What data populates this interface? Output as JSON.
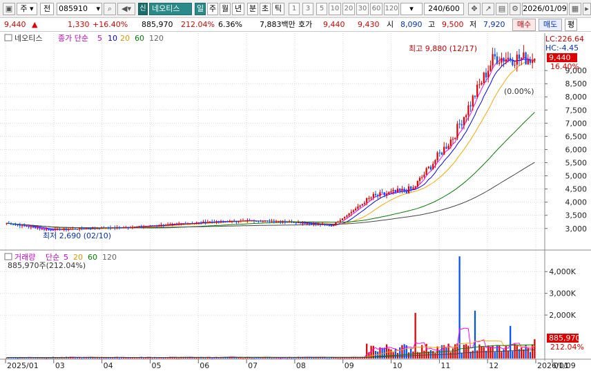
{
  "toolbar": {
    "market": "주",
    "market_btn": "전",
    "code": "085910",
    "name_badge": "신",
    "stock_name": "네오티스",
    "periods": [
      "일",
      "주",
      "월",
      "년",
      "분",
      "초",
      "틱"
    ],
    "active_period": "일",
    "intervals": [
      "1",
      "3",
      "5",
      "10",
      "20",
      "30",
      "60",
      "120"
    ],
    "count": "240",
    "count_max": "/600",
    "date": "2026/01/09"
  },
  "quote": {
    "price": "9,440",
    "arrow": "▲",
    "change": "1,330",
    "change_pct": "+16.40%",
    "volume": "885,970",
    "vol_ratio": "212.04%",
    "turnover": "6.36%",
    "amount": "7,883백만",
    "ask_label": "호가",
    "ask": "9,440",
    "bid": "9,430",
    "open_label": "시",
    "open": "8,090",
    "high_label": "고",
    "high": "9,500",
    "low_label": "저",
    "low": "7,920",
    "buy_btn": "매수",
    "sell_btn": "매도",
    "eval_btn": "평"
  },
  "legend": {
    "price_name": "네오티스",
    "price_ind": "종가 단순",
    "ma": [
      "5",
      "10",
      "20",
      "60",
      "120"
    ],
    "vol_name": "거래량",
    "vol_ind": "단순",
    "vol_ma": [
      "5",
      "20",
      "60",
      "120"
    ],
    "vol_value": "885,970주(212.04%)"
  },
  "annotations": {
    "high": "최고 9,880 (12/17)",
    "low": "최저 2,690 (02/10)",
    "center": "(0.00%)",
    "lc": "LC:226.64",
    "hc": "HC:-4.45"
  },
  "chart_data": {
    "type": "candlestick",
    "x_labels": [
      "2025/01",
      "03",
      "04",
      "05",
      "06",
      "07",
      "08",
      "09",
      "10",
      "11",
      "12",
      "2026/01",
      "01/09"
    ],
    "price_axis": {
      "ticks": [
        "3,000",
        "3,500",
        "4,000",
        "4,500",
        "5,000",
        "5,500",
        "6,000",
        "6,500",
        "7,000",
        "7,500",
        "8,000",
        "8,500",
        "9,000"
      ],
      "min": 2600,
      "max": 10000
    },
    "last_price": "9,440",
    "last_pct": "16.40%",
    "volume_axis": {
      "ticks": [
        "2,000K",
        "3,000K",
        "4,000K"
      ],
      "min": 0,
      "max": 4800000
    },
    "last_volume": "885,970",
    "last_vol_pct": "212.04%",
    "ma_colors": {
      "5": "#ff00ff",
      "10": "#0000ff",
      "20": "#ffa500",
      "60": "#008000",
      "120": "#444444"
    },
    "colors": {
      "up": "#e00000",
      "down": "#0050ff",
      "volume_label_bg": "#e00000",
      "price_label_bg": "#e00000"
    },
    "price_series": [
      {
        "month": "2025/01",
        "close": 3200
      },
      {
        "month": "02",
        "close": 2950
      },
      {
        "month": "03",
        "close": 3000
      },
      {
        "month": "04",
        "close": 3050
      },
      {
        "month": "05",
        "close": 3150
      },
      {
        "month": "06",
        "close": 3250
      },
      {
        "month": "07",
        "close": 3300
      },
      {
        "month": "08",
        "close": 3250
      },
      {
        "month": "09",
        "close": 3100
      },
      {
        "month": "10",
        "close": 4200
      },
      {
        "month": "11",
        "close": 4500
      },
      {
        "month": "11-late",
        "close": 6500
      },
      {
        "month": "12",
        "close": 9500
      },
      {
        "month": "2026/01",
        "close": 9440
      }
    ],
    "volume_peaks": [
      {
        "month": "09-late",
        "value": 2100000
      },
      {
        "month": "11",
        "value": 4700000
      },
      {
        "month": "11-late",
        "value": 2200000
      },
      {
        "month": "12",
        "value": 1500000
      },
      {
        "month": "2026/01",
        "value": 885970
      }
    ]
  }
}
